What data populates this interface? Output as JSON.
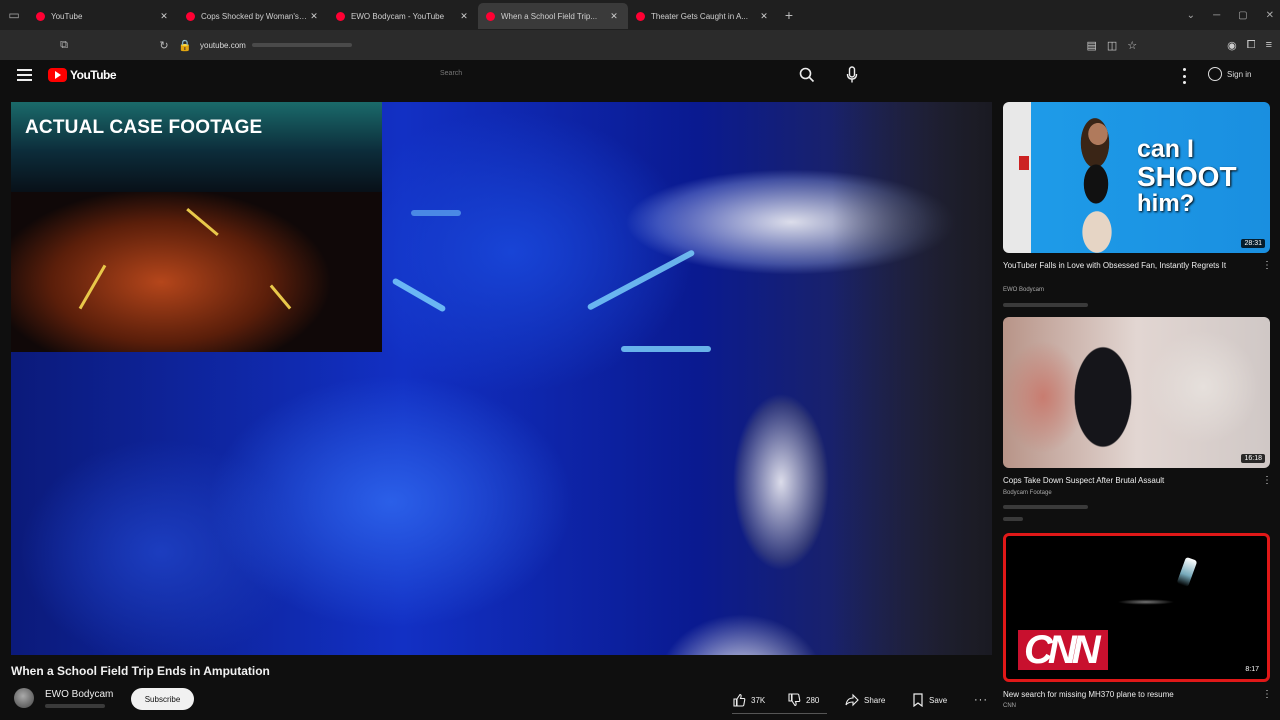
{
  "browser": {
    "tabs": [
      {
        "title": "YouTube",
        "active": false
      },
      {
        "title": "Cops Shocked by Woman's Per...",
        "active": false
      },
      {
        "title": "EWO Bodycam - YouTube",
        "active": false
      },
      {
        "title": "When a School Field Trip...",
        "active": true
      },
      {
        "title": "Theater Gets Caught in A...",
        "active": false
      }
    ],
    "url": "youtube.com",
    "new_tab": "+"
  },
  "youtube": {
    "logo_text": "YouTube",
    "search_placeholder": "Search",
    "sign_in": "Sign in"
  },
  "video": {
    "overlay_label": "ACTUAL CASE FOOTAGE",
    "title": "When a School Field Trip Ends in Amputation",
    "channel": "EWO Bodycam",
    "subscribe_label": "Subscribe",
    "likes": "37K",
    "dislikes": "280",
    "share_label": "Share",
    "save_label": "Save",
    "more": "···"
  },
  "recommendations": [
    {
      "thumb_text": [
        "can I",
        "SHOOT",
        "him?"
      ],
      "duration": "28:31",
      "title": "YouTuber Falls in Love with Obsessed Fan, Instantly Regrets It",
      "channel": "EWO Bodycam"
    },
    {
      "duration": "16:18",
      "title": "Cops Take Down Suspect After Brutal Assault",
      "channel": "Bodycam Footage"
    },
    {
      "thumb_text": "CNN",
      "duration": "8:17",
      "title": "New search for missing MH370 plane to resume",
      "channel": "CNN"
    }
  ],
  "colors": {
    "youtube_red": "#ff0000",
    "cnn_red": "#c8102e",
    "background": "#0f0f0f"
  }
}
